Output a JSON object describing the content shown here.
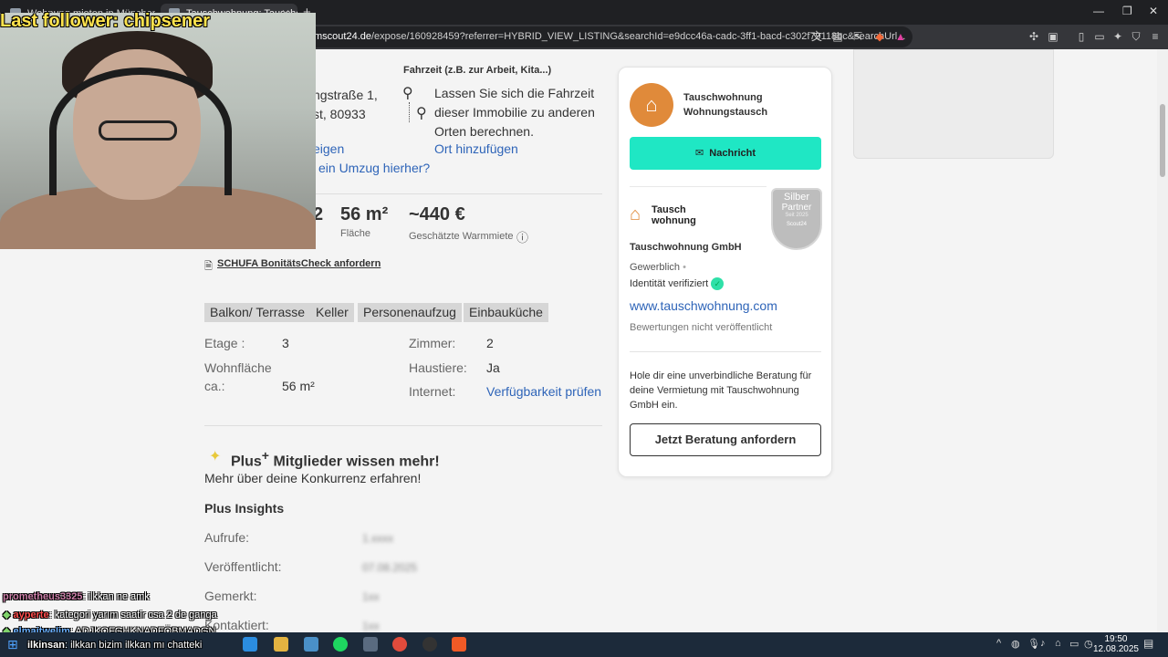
{
  "browser": {
    "tabs": [
      {
        "label": "Wohnung mieten in München - Imm"
      },
      {
        "label": "Tauschwohnung: Tausche 2-Zim"
      }
    ],
    "new_tab": "+",
    "url_host": "mscout24.de",
    "url_path": "/expose/160928459?referrer=HYBRID_VIEW_LISTING&searchId=e9dcc46a-cadc-3ff1-bacd-c302f79118bc&searchUrl..."
  },
  "overlay": {
    "follower": "Last follower: chipsener",
    "chat": [
      {
        "user": "prometheus3325",
        "text": ": ilkkan ne amk",
        "color": "#cc7fa8"
      },
      {
        "user": "ayperte",
        "text": ": kategori yarım saatir csa 2 de ganga",
        "color": "#ff4d4d"
      },
      {
        "user": "elmaitwelim",
        "text": ": ADJKOFGHKNADFÖBMADGN",
        "color": "#6ab0ff"
      },
      {
        "user": "ilkinsan",
        "text": ": ilkkan bizim ilkkan mı chatteki",
        "color": "#ffffff"
      }
    ]
  },
  "listing": {
    "address_line1": "ngstraße 1,",
    "address_line2": "st, 80933",
    "address_link1": "eigen",
    "address_link2": "ein Umzug hierher?",
    "fahrzeit_title": "Fahrzeit (z.B. zur Arbeit, Kita...)",
    "fahrzeit_text": "Lassen Sie sich die Fahrzeit dieser Immobilie zu anderen Orten berechnen.",
    "fahrzeit_link": "Ort hinzufügen",
    "flaeche_value": "56 m²",
    "flaeche_label": "Fläche",
    "miete_value": "~440 €",
    "miete_label": "Geschätzte Warmmiete",
    "schufa": "SCHUFA BonitätsCheck anfordern",
    "features": [
      "Balkon/ Terrasse",
      "Keller",
      "Personenaufzug",
      "Einbauküche"
    ],
    "facts": {
      "etage_label": "Etage :",
      "etage_value": "3",
      "wohnflaeche_label1": "Wohnfläche",
      "wohnflaeche_label2": "ca.:",
      "wohnflaeche_value": "56 m²",
      "zimmer_label": "Zimmer:",
      "zimmer_value": "2",
      "haustiere_label": "Haustiere:",
      "haustiere_value": "Ja",
      "internet_label": "Internet:",
      "internet_link": "Verfügbarkeit prüfen"
    },
    "plus_title_a": "Plus",
    "plus_title_b": "Mitglieder wissen mehr!",
    "plus_sub": "Mehr über deine Konkurrenz erfahren!",
    "insights_title": "Plus Insights",
    "insights": [
      {
        "label": "Aufrufe:",
        "value": "1.xxxx"
      },
      {
        "label": "Veröffentlicht:",
        "value": "07.08.2025"
      },
      {
        "label": "Gemerkt:",
        "value": "1xx"
      },
      {
        "label": "Kontaktiert:",
        "value": "1xx"
      }
    ]
  },
  "card": {
    "name_line1": "Tauschwohnung",
    "name_line2": "Wohnungstausch",
    "message_button": "Nachricht",
    "badge_line1": "Silber",
    "badge_line2": "Partner",
    "badge_since": "Seit 2025",
    "badge_brand": "Scout24",
    "logo_line1": "Tausch",
    "logo_line2": "wohnung",
    "company": "Tauschwohnung GmbH",
    "type": "Gewerblich",
    "verified": "Identität verifiziert",
    "website": "www.tauschwohnung.com",
    "ratings": "Bewertungen nicht veröffentlicht",
    "advice_text": "Hole dir eine unverbindliche Beratung für deine Vermietung mit Tauschwohnung GmbH ein.",
    "advice_button": "Jetzt Beratung anfordern"
  },
  "taskbar": {
    "time": "19:50",
    "date": "12.08.2025"
  }
}
